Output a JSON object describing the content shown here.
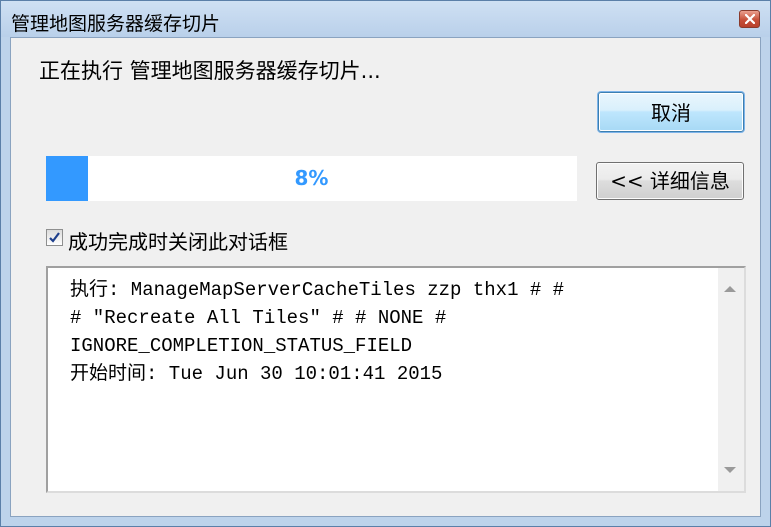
{
  "window": {
    "title": "管理地图服务器缓存切片",
    "close_icon": "close-icon"
  },
  "status": {
    "text": "正在执行 管理地图服务器缓存切片..."
  },
  "buttons": {
    "cancel_label": "取消",
    "details_label": "<< 详细信息"
  },
  "progress": {
    "percent": 8,
    "label": "8%"
  },
  "checkbox": {
    "label": "成功完成时关闭此对话框",
    "checked": true
  },
  "log": {
    "lines": [
      "执行: ManageMapServerCacheTiles zzp thx1 # #",
      "# \"Recreate All Tiles\" # # NONE #",
      "IGNORE_COMPLETION_STATUS_FIELD",
      "开始时间: Tue Jun 30 10:01:41 2015"
    ]
  },
  "colors": {
    "progress_fill": "#3399ff",
    "titlebar": "#bdd3eb"
  }
}
